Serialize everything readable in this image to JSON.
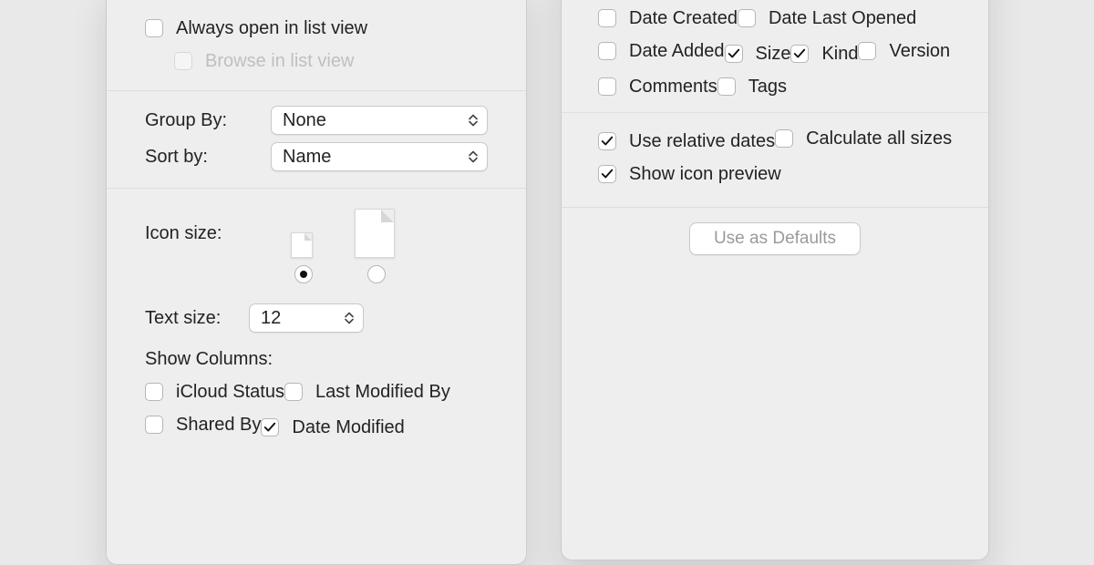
{
  "left": {
    "always_open": {
      "label": "Always open in list view",
      "checked": false
    },
    "browse_in": {
      "label": "Browse in list view",
      "checked": false,
      "disabled": true
    },
    "group_by": {
      "label": "Group By:",
      "value": "None"
    },
    "sort_by": {
      "label": "Sort by:",
      "value": "Name"
    },
    "icon_size": {
      "label": "Icon size:",
      "selected": "small"
    },
    "text_size": {
      "label": "Text size:",
      "value": "12"
    },
    "show_columns_label": "Show Columns:",
    "columns": [
      {
        "label": "iCloud Status",
        "checked": false
      },
      {
        "label": "Last Modified By",
        "checked": false
      },
      {
        "label": "Shared By",
        "checked": false
      },
      {
        "label": "Date Modified",
        "checked": true
      }
    ]
  },
  "right": {
    "columns": [
      {
        "label": "Date Created",
        "checked": false
      },
      {
        "label": "Date Last Opened",
        "checked": false
      },
      {
        "label": "Date Added",
        "checked": false
      },
      {
        "label": "Size",
        "checked": true
      },
      {
        "label": "Kind",
        "checked": true
      },
      {
        "label": "Version",
        "checked": false
      },
      {
        "label": "Comments",
        "checked": false
      },
      {
        "label": "Tags",
        "checked": false
      }
    ],
    "options": [
      {
        "label": "Use relative dates",
        "checked": true
      },
      {
        "label": "Calculate all sizes",
        "checked": false
      },
      {
        "label": "Show icon preview",
        "checked": true
      }
    ],
    "defaults_button": "Use as Defaults"
  }
}
